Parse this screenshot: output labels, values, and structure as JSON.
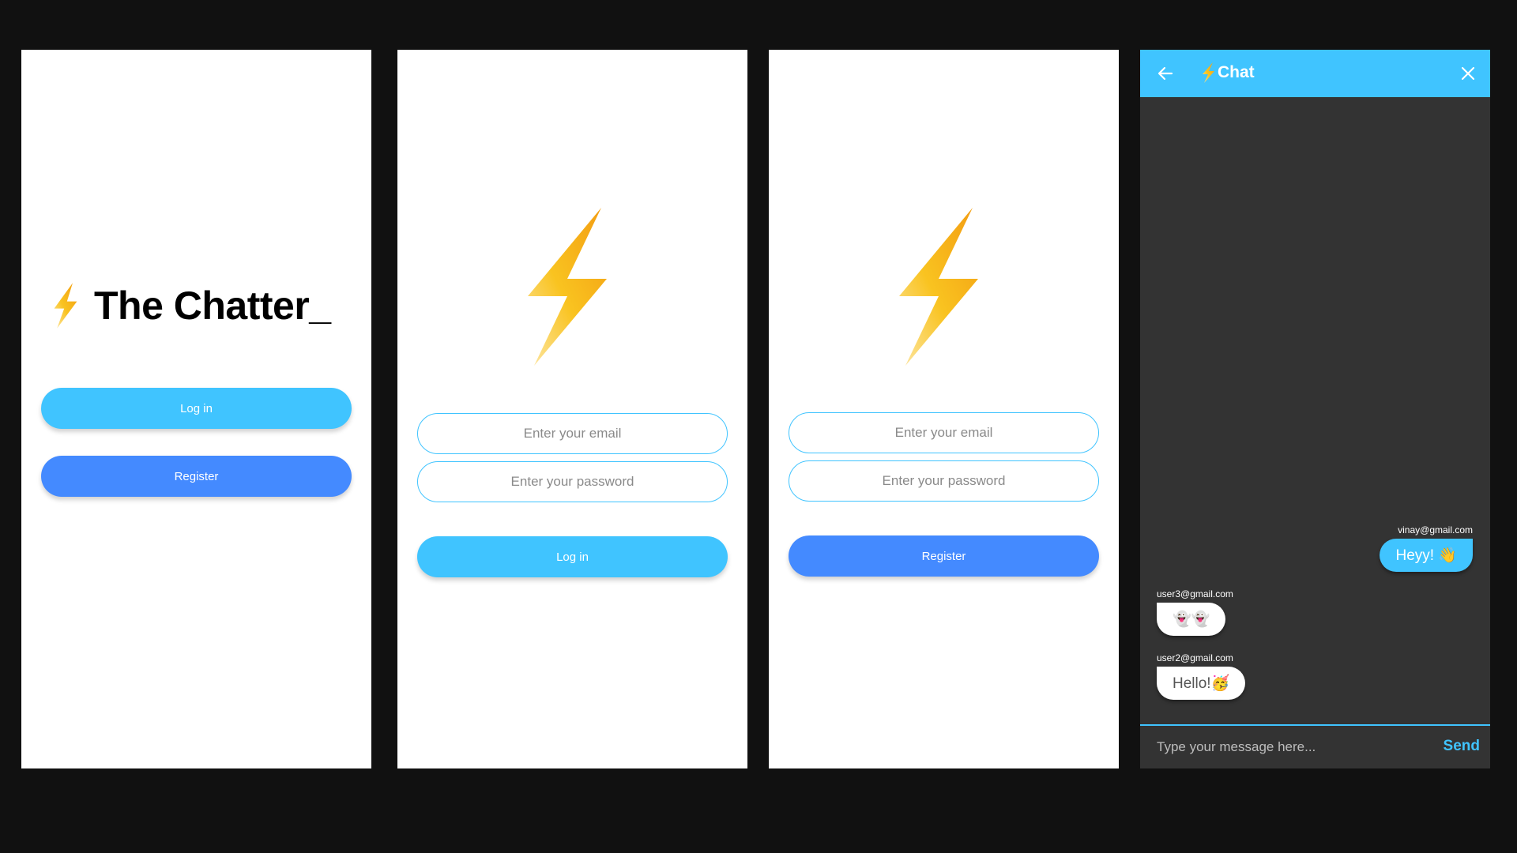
{
  "colors": {
    "background": "#111111",
    "light_blue": "#40c4ff",
    "blue": "#448aff",
    "bolt": "#f5a623",
    "chat_background": "#333333"
  },
  "welcome": {
    "title": "The Chatter_",
    "login_label": "Log in",
    "register_label": "Register",
    "logo_icon": "lightning-bolt-icon"
  },
  "login": {
    "email_placeholder": "Enter your email",
    "password_placeholder": "Enter your password",
    "login_label": "Log in",
    "logo_icon": "lightning-bolt-icon"
  },
  "register": {
    "email_placeholder": "Enter your email",
    "password_placeholder": "Enter your password",
    "register_label": "Register",
    "logo_icon": "lightning-bolt-icon"
  },
  "chat": {
    "title": "Chat",
    "back_icon": "arrow-left-icon",
    "close_icon": "close-icon",
    "messages": [
      {
        "sender": "vinay@gmail.com",
        "text": "Heyy! 👋",
        "is_me": true
      },
      {
        "sender": "user3@gmail.com",
        "text": "👻👻",
        "is_me": false
      },
      {
        "sender": "user2@gmail.com",
        "text": "Hello!🥳",
        "is_me": false
      }
    ],
    "input_placeholder": "Type your message here...",
    "send_label": "Send"
  }
}
